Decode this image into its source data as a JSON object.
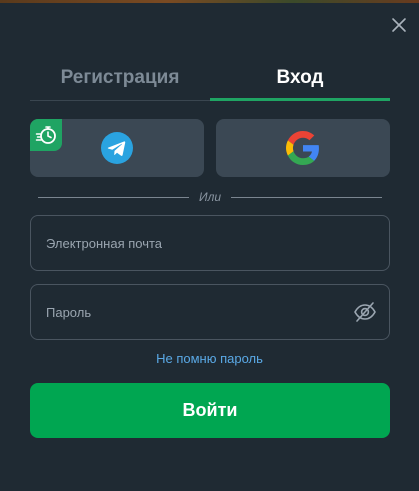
{
  "tabs": {
    "register_label": "Регистрация",
    "login_label": "Вход",
    "active": "login"
  },
  "social": {
    "telegram_icon": "telegram-icon",
    "google_icon": "google-icon",
    "promo_icon": "bonus-timer-icon"
  },
  "divider": {
    "text": "Или"
  },
  "form": {
    "email_placeholder": "Электронная почта",
    "email_value": "",
    "password_placeholder": "Пароль",
    "password_value": "",
    "forgot_label": "Не помню пароль",
    "submit_label": "Войти"
  },
  "colors": {
    "background": "#1f2a33",
    "accent_green": "#00a651",
    "tab_underline": "#1fa463",
    "social_button": "#3b4854",
    "link_blue": "#5aa9e6",
    "telegram_blue": "#2aa3e0"
  }
}
